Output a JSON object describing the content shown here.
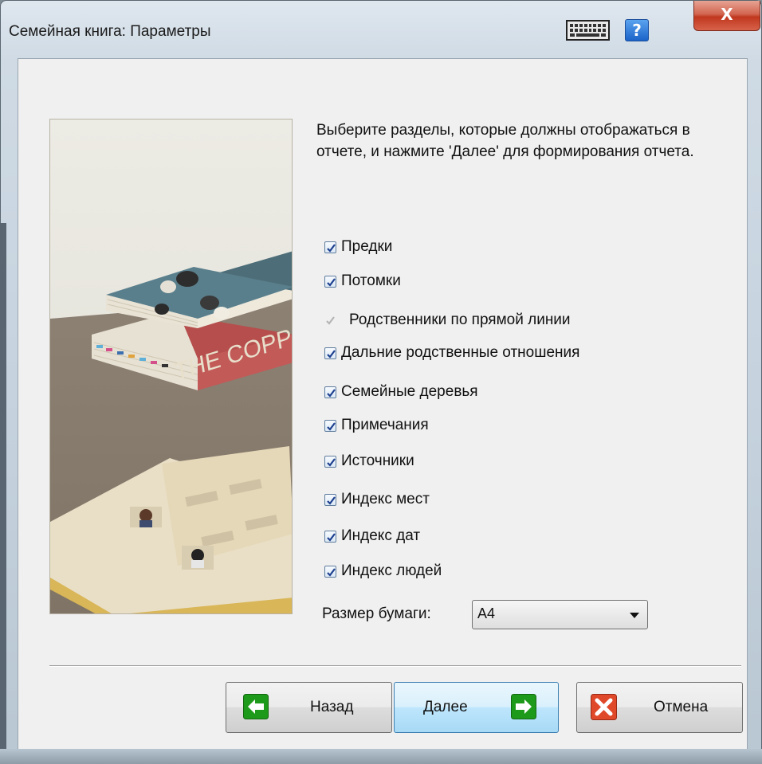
{
  "window": {
    "title": "Семейная книга: Параметры",
    "icons": [
      "keyboard-icon",
      "help-icon",
      "close-icon"
    ],
    "help_glyph": "?",
    "close_glyph": "X"
  },
  "intro_text": "Выберите разделы, которые должны отображаться в отчете, и нажмите 'Далее' для формирования отчета.",
  "illustration_text": "THE COPP",
  "options": [
    {
      "label": "Предки",
      "checked": true,
      "enabled": true
    },
    {
      "label": "Потомки",
      "checked": true,
      "enabled": true
    },
    {
      "label": "Родственники по прямой линии",
      "checked": true,
      "enabled": false
    },
    {
      "label": "Дальние родственные отношения",
      "checked": true,
      "enabled": true
    },
    {
      "label": "Семейные деревья",
      "checked": true,
      "enabled": true
    },
    {
      "label": "Примечания",
      "checked": true,
      "enabled": true
    },
    {
      "label": "Источники",
      "checked": true,
      "enabled": true
    },
    {
      "label": "Индекс мест",
      "checked": true,
      "enabled": true
    },
    {
      "label": "Индекс дат",
      "checked": true,
      "enabled": true
    },
    {
      "label": "Индекс людей",
      "checked": true,
      "enabled": true
    }
  ],
  "paper": {
    "label": "Размер бумаги:",
    "value": "A4"
  },
  "buttons": {
    "back": "Назад",
    "next": "Далее",
    "cancel": "Отмена"
  },
  "colors": {
    "arrow_green": "#1e9a1a",
    "cancel_red": "#e0482a",
    "primary_button": "#bee6fd"
  }
}
